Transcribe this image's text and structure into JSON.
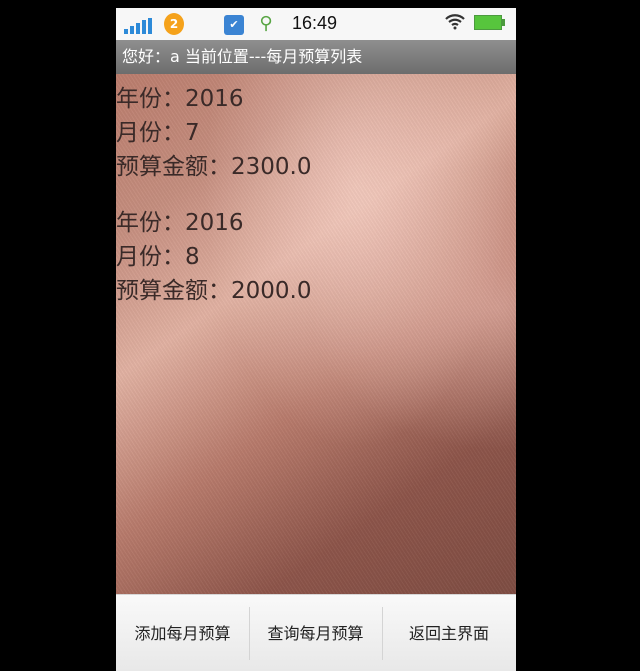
{
  "status_bar": {
    "time": "16:49",
    "badge_count": "2",
    "icons": {
      "signal": "signal-bars-icon",
      "badge": "app-badge-icon",
      "app": "app-icon",
      "usb": "usb-icon",
      "wifi": "wifi-icon",
      "battery": "battery-icon"
    },
    "colors": {
      "signal": "#2d8ad8",
      "badge": "#f5a21b",
      "battery": "#57c53d"
    }
  },
  "title_bar": {
    "text": "您好：a  当前位置---每月预算列表"
  },
  "records": [
    {
      "year": "年份：2016",
      "month": "月份：7",
      "amount": "预算金额：2300.0"
    },
    {
      "year": "年份：2016",
      "month": "月份：8",
      "amount": "预算金额：2000.0"
    }
  ],
  "bottom_menu": {
    "add_label": "添加每月预算",
    "query_label": "查询每月预算",
    "back_label": "返回主界面"
  }
}
